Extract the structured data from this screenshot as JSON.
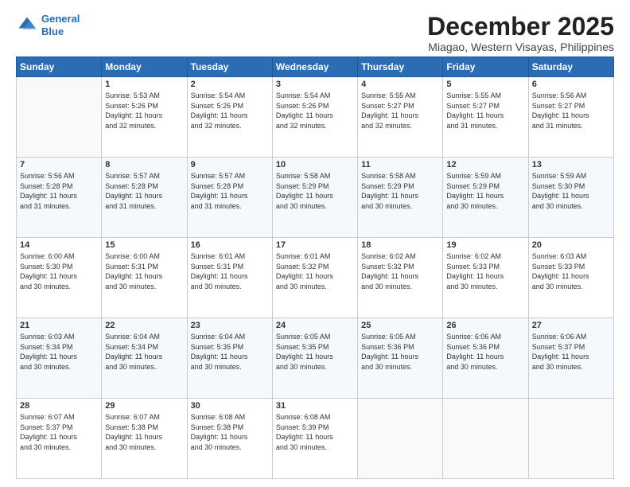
{
  "logo": {
    "line1": "General",
    "line2": "Blue"
  },
  "title": "December 2025",
  "location": "Miagao, Western Visayas, Philippines",
  "days_header": [
    "Sunday",
    "Monday",
    "Tuesday",
    "Wednesday",
    "Thursday",
    "Friday",
    "Saturday"
  ],
  "weeks": [
    [
      {
        "day": "",
        "info": ""
      },
      {
        "day": "1",
        "info": "Sunrise: 5:53 AM\nSunset: 5:26 PM\nDaylight: 11 hours\nand 32 minutes."
      },
      {
        "day": "2",
        "info": "Sunrise: 5:54 AM\nSunset: 5:26 PM\nDaylight: 11 hours\nand 32 minutes."
      },
      {
        "day": "3",
        "info": "Sunrise: 5:54 AM\nSunset: 5:26 PM\nDaylight: 11 hours\nand 32 minutes."
      },
      {
        "day": "4",
        "info": "Sunrise: 5:55 AM\nSunset: 5:27 PM\nDaylight: 11 hours\nand 32 minutes."
      },
      {
        "day": "5",
        "info": "Sunrise: 5:55 AM\nSunset: 5:27 PM\nDaylight: 11 hours\nand 31 minutes."
      },
      {
        "day": "6",
        "info": "Sunrise: 5:56 AM\nSunset: 5:27 PM\nDaylight: 11 hours\nand 31 minutes."
      }
    ],
    [
      {
        "day": "7",
        "info": "Sunrise: 5:56 AM\nSunset: 5:28 PM\nDaylight: 11 hours\nand 31 minutes."
      },
      {
        "day": "8",
        "info": "Sunrise: 5:57 AM\nSunset: 5:28 PM\nDaylight: 11 hours\nand 31 minutes."
      },
      {
        "day": "9",
        "info": "Sunrise: 5:57 AM\nSunset: 5:28 PM\nDaylight: 11 hours\nand 31 minutes."
      },
      {
        "day": "10",
        "info": "Sunrise: 5:58 AM\nSunset: 5:29 PM\nDaylight: 11 hours\nand 30 minutes."
      },
      {
        "day": "11",
        "info": "Sunrise: 5:58 AM\nSunset: 5:29 PM\nDaylight: 11 hours\nand 30 minutes."
      },
      {
        "day": "12",
        "info": "Sunrise: 5:59 AM\nSunset: 5:29 PM\nDaylight: 11 hours\nand 30 minutes."
      },
      {
        "day": "13",
        "info": "Sunrise: 5:59 AM\nSunset: 5:30 PM\nDaylight: 11 hours\nand 30 minutes."
      }
    ],
    [
      {
        "day": "14",
        "info": "Sunrise: 6:00 AM\nSunset: 5:30 PM\nDaylight: 11 hours\nand 30 minutes."
      },
      {
        "day": "15",
        "info": "Sunrise: 6:00 AM\nSunset: 5:31 PM\nDaylight: 11 hours\nand 30 minutes."
      },
      {
        "day": "16",
        "info": "Sunrise: 6:01 AM\nSunset: 5:31 PM\nDaylight: 11 hours\nand 30 minutes."
      },
      {
        "day": "17",
        "info": "Sunrise: 6:01 AM\nSunset: 5:32 PM\nDaylight: 11 hours\nand 30 minutes."
      },
      {
        "day": "18",
        "info": "Sunrise: 6:02 AM\nSunset: 5:32 PM\nDaylight: 11 hours\nand 30 minutes."
      },
      {
        "day": "19",
        "info": "Sunrise: 6:02 AM\nSunset: 5:33 PM\nDaylight: 11 hours\nand 30 minutes."
      },
      {
        "day": "20",
        "info": "Sunrise: 6:03 AM\nSunset: 5:33 PM\nDaylight: 11 hours\nand 30 minutes."
      }
    ],
    [
      {
        "day": "21",
        "info": "Sunrise: 6:03 AM\nSunset: 5:34 PM\nDaylight: 11 hours\nand 30 minutes."
      },
      {
        "day": "22",
        "info": "Sunrise: 6:04 AM\nSunset: 5:34 PM\nDaylight: 11 hours\nand 30 minutes."
      },
      {
        "day": "23",
        "info": "Sunrise: 6:04 AM\nSunset: 5:35 PM\nDaylight: 11 hours\nand 30 minutes."
      },
      {
        "day": "24",
        "info": "Sunrise: 6:05 AM\nSunset: 5:35 PM\nDaylight: 11 hours\nand 30 minutes."
      },
      {
        "day": "25",
        "info": "Sunrise: 6:05 AM\nSunset: 5:36 PM\nDaylight: 11 hours\nand 30 minutes."
      },
      {
        "day": "26",
        "info": "Sunrise: 6:06 AM\nSunset: 5:36 PM\nDaylight: 11 hours\nand 30 minutes."
      },
      {
        "day": "27",
        "info": "Sunrise: 6:06 AM\nSunset: 5:37 PM\nDaylight: 11 hours\nand 30 minutes."
      }
    ],
    [
      {
        "day": "28",
        "info": "Sunrise: 6:07 AM\nSunset: 5:37 PM\nDaylight: 11 hours\nand 30 minutes."
      },
      {
        "day": "29",
        "info": "Sunrise: 6:07 AM\nSunset: 5:38 PM\nDaylight: 11 hours\nand 30 minutes."
      },
      {
        "day": "30",
        "info": "Sunrise: 6:08 AM\nSunset: 5:38 PM\nDaylight: 11 hours\nand 30 minutes."
      },
      {
        "day": "31",
        "info": "Sunrise: 6:08 AM\nSunset: 5:39 PM\nDaylight: 11 hours\nand 30 minutes."
      },
      {
        "day": "",
        "info": ""
      },
      {
        "day": "",
        "info": ""
      },
      {
        "day": "",
        "info": ""
      }
    ]
  ]
}
